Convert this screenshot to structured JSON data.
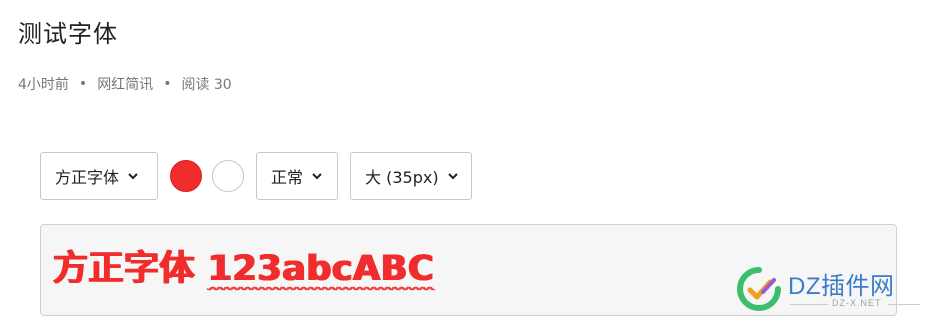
{
  "article": {
    "title": "测试字体",
    "meta": {
      "time": "4小时前",
      "category": "网红简讯",
      "reads_label": "阅读 30",
      "separator": "•"
    }
  },
  "toolbar": {
    "font_select": {
      "value": "方正字体"
    },
    "colors": [
      {
        "name": "red",
        "hex": "#f02c2c",
        "selected": true
      },
      {
        "name": "white",
        "hex": "#ffffff",
        "selected": false
      }
    ],
    "weight_select": {
      "value": "正常"
    },
    "size_select": {
      "value": "大 (35px)"
    }
  },
  "preview": {
    "text_cjk": "方正字体",
    "text_alnum": "123abcABC",
    "color": "#f02c2c"
  },
  "watermark": {
    "text": "DZ插件网",
    "subtext": "DZ-X.NET"
  }
}
